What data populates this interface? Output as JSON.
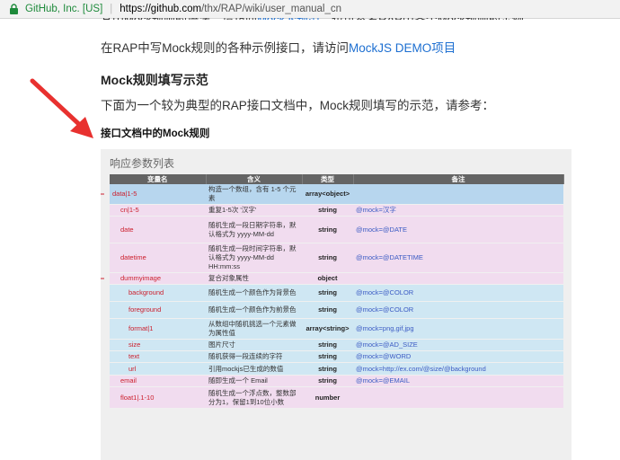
{
  "browser": {
    "site_identity": "GitHub, Inc. [US]",
    "url_host": "https://github.com",
    "url_path": "/thx/RAP/wiki/user_manual_cn"
  },
  "article": {
    "cut_line_start": "其中Mock规则的语法，请访问",
    "cut_line_link": "Mock.js规范",
    "cut_line_end": "，也可参考RAP中各个Mock规则的示例。",
    "paragraph1_prefix": "在RAP中写Mock规则的各种示例接口，请访问",
    "paragraph1_link": "MockJS DEMO项目",
    "heading_example": "Mock规则填写示范",
    "paragraph2": "下面为一个较为典型的RAP接口文档中，Mock规则填写的示范，请参考：",
    "heading_mock_rules": "接口文档中的Mock规则"
  },
  "figure": {
    "title": "响应参数列表",
    "columns": [
      "变量名",
      "含义",
      "类型",
      "备注"
    ],
    "rows": [
      {
        "name": "data|1-5",
        "desc": "构造一个数组，含有 1-5 个元素",
        "type": "array<object>",
        "note": "",
        "level": 0,
        "style": "hl",
        "collapse": true
      },
      {
        "name": "cn|1-5",
        "desc": "重复1-5次 '汉字'",
        "type": "string",
        "note": "@mock=汉字",
        "level": 1,
        "style": "pink",
        "collapse": false
      },
      {
        "name": "date",
        "desc": "随机生成一段日期字符串，默认格式为 yyyy-MM-dd",
        "type": "string",
        "note": "@mock=@DATE",
        "level": 1,
        "style": "pink",
        "collapse": false
      },
      {
        "name": "datetime",
        "desc": "随机生成一段时间字符串，默认格式为 yyyy-MM-dd HH:mm:ss",
        "type": "string",
        "note": "@mock=@DATETIME",
        "level": 1,
        "style": "pink",
        "collapse": false
      },
      {
        "name": "dummyimage",
        "desc": "复合对象属性",
        "type": "object",
        "note": "",
        "level": 1,
        "style": "pink",
        "collapse": true
      },
      {
        "name": "background",
        "desc": "随机生成一个颜色作为背景色",
        "type": "string",
        "note": "@mock=@COLOR",
        "level": 2,
        "style": "blue",
        "collapse": false
      },
      {
        "name": "foreground",
        "desc": "随机生成一个颜色作为前景色",
        "type": "string",
        "note": "@mock=@COLOR",
        "level": 2,
        "style": "blue",
        "collapse": false
      },
      {
        "name": "format|1",
        "desc": "从数组中随机挑选一个元素做为属性值",
        "type": "array<string>",
        "note": "@mock=png,gif,jpg",
        "level": 2,
        "style": "blue",
        "collapse": false
      },
      {
        "name": "size",
        "desc": "图片尺寸",
        "type": "string",
        "note": "@mock=@AD_SIZE",
        "level": 2,
        "style": "blue",
        "collapse": false
      },
      {
        "name": "text",
        "desc": "随机获得一段连续的字符",
        "type": "string",
        "note": "@mock=@WORD",
        "level": 2,
        "style": "blue",
        "collapse": false
      },
      {
        "name": "url",
        "desc": "引用mockjs已生成的数值",
        "type": "string",
        "note": "@mock=http://ex.com/@size/@background",
        "level": 2,
        "style": "blue",
        "collapse": false
      },
      {
        "name": "email",
        "desc": "随即生成一个 Email",
        "type": "string",
        "note": "@mock=@EMAIL",
        "level": 1,
        "style": "pink",
        "collapse": false
      },
      {
        "name": "float1|.1-10",
        "desc": "随机生成一个浮点数，整数部分为1，保留1到10位小数",
        "type": "number",
        "note": "",
        "level": 1,
        "style": "pink",
        "collapse": false
      }
    ]
  },
  "colors": {
    "link": "#1d6fd1",
    "annotation_arrow": "#e8312f",
    "row_blue": "#cfe7f3",
    "row_pink": "#f1dcef",
    "header": "#646464"
  }
}
